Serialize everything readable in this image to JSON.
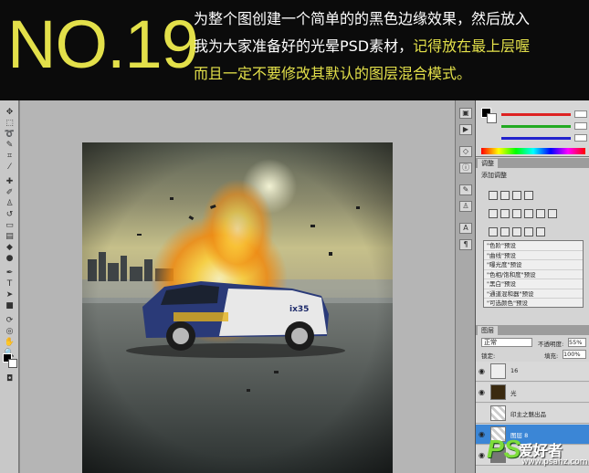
{
  "banner": {
    "number": "NO.19",
    "line1": "为整个图创建一个简单的的黑色边缘效果，然后放入",
    "line2_a": "我为大家准备好的光晕PSD素材，",
    "line2_b": "记得放在最上层喔",
    "line3": "而且一定不要修改其默认的图层混合模式。",
    "colors": {
      "accent": "#e3e04a",
      "text": "#ffffff",
      "background": "#0b0b0b"
    }
  },
  "canvas": {
    "car_badge": "ix35"
  },
  "color_panel": {
    "sliders": [
      {
        "channel": "R",
        "color": "#d22"
      },
      {
        "channel": "G",
        "color": "#2a2"
      },
      {
        "channel": "B",
        "color": "#22c"
      }
    ]
  },
  "adjustments": {
    "tab_label": "调整",
    "title": "添加调整",
    "presets": [
      "\"色阶\"预设",
      "\"曲线\"预设",
      "\"曝光度\"预设",
      "\"色相/饱和度\"预设",
      "\"黑白\"预设",
      "\"通道混和器\"预设",
      "\"可选颜色\"预设"
    ]
  },
  "layers_panel": {
    "tab_label": "图层",
    "blend_mode": "正常",
    "opacity_label": "不透明度:",
    "opacity_value": "55%",
    "lock_label": "锁定:",
    "fill_label": "填充:",
    "fill_value": "100%",
    "layers": [
      {
        "name": "16",
        "selected": false
      },
      {
        "name": "光",
        "selected": false
      },
      {
        "name": "印主之魅出品",
        "selected": false
      },
      {
        "name": "图层 8",
        "selected": true
      },
      {
        "name": "",
        "selected": false
      }
    ]
  },
  "watermark": {
    "ps": "PS",
    "cn": "爱好者",
    "url": "www.psahz.com"
  }
}
